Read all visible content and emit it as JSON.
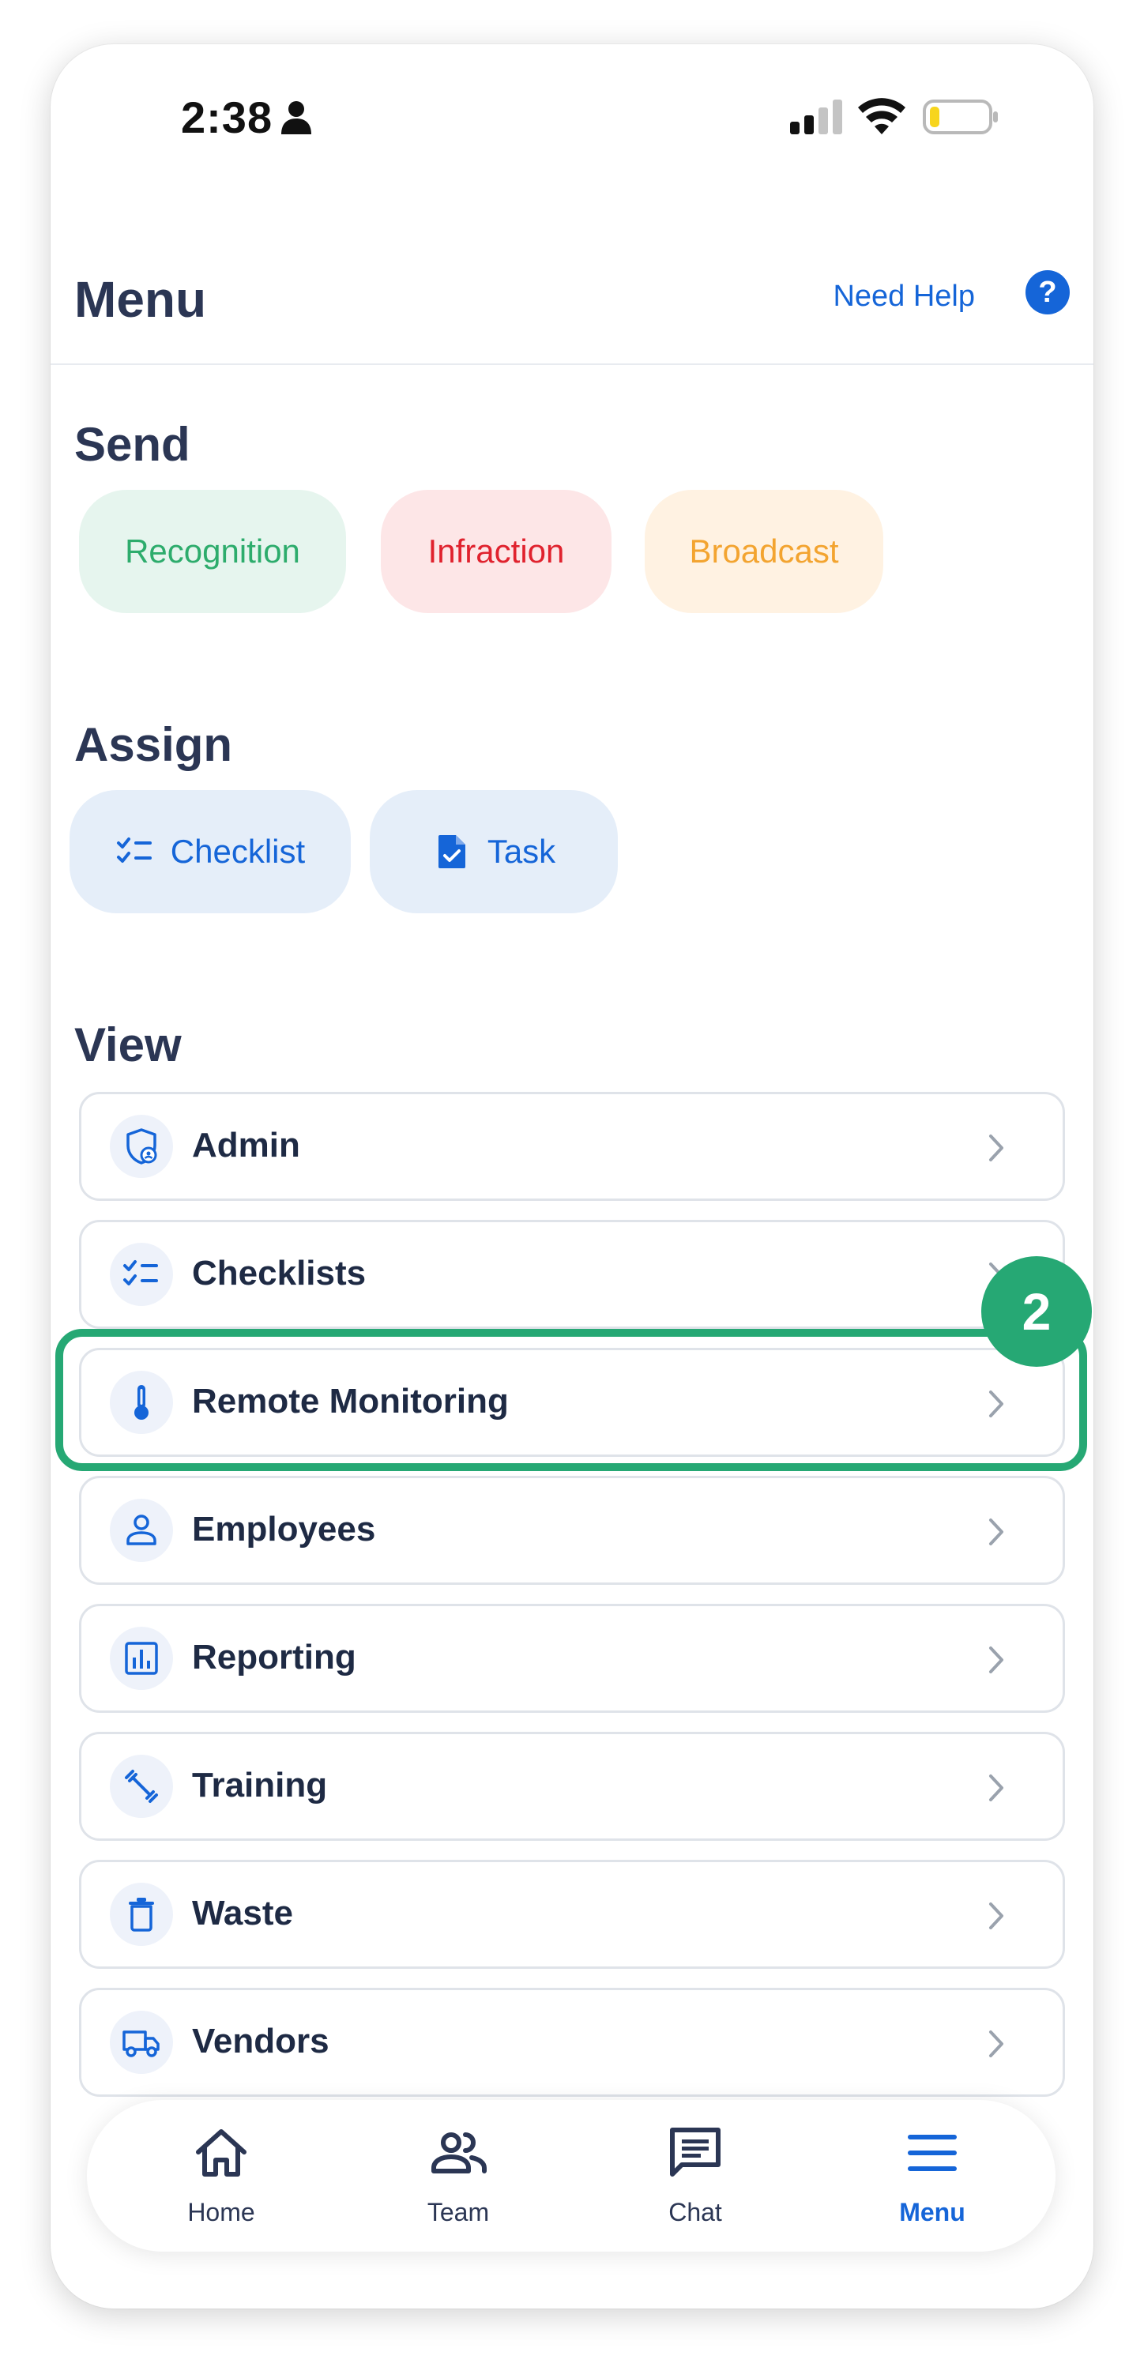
{
  "status_bar": {
    "time": "2:38"
  },
  "header": {
    "title": "Menu",
    "help_label": "Need Help",
    "help_icon_glyph": "?"
  },
  "sections": {
    "send": {
      "title": "Send",
      "chips": [
        "Recognition",
        "Infraction",
        "Broadcast"
      ]
    },
    "assign": {
      "title": "Assign",
      "chips": [
        "Checklist",
        "Task"
      ]
    },
    "view": {
      "title": "View"
    }
  },
  "list_items": [
    {
      "label": "Admin",
      "icon": "shield-user-icon"
    },
    {
      "label": "Checklists",
      "icon": "checklist-icon"
    },
    {
      "label": "Remote Monitoring",
      "icon": "thermometer-icon"
    },
    {
      "label": "Employees",
      "icon": "person-icon"
    },
    {
      "label": "Reporting",
      "icon": "bar-chart-icon"
    },
    {
      "label": "Training",
      "icon": "dumbbell-icon"
    },
    {
      "label": "Waste",
      "icon": "trash-icon"
    },
    {
      "label": "Vendors",
      "icon": "truck-icon"
    }
  ],
  "step_badge": "2",
  "bottom_nav": [
    {
      "label": "Home",
      "icon": "home-icon",
      "active": false
    },
    {
      "label": "Team",
      "icon": "team-icon",
      "active": false
    },
    {
      "label": "Chat",
      "icon": "chat-icon",
      "active": false
    },
    {
      "label": "Menu",
      "icon": "menu-icon",
      "active": true
    }
  ],
  "colors": {
    "accent": "#1565d8",
    "highlight": "#26a874",
    "recognition": "#2dac6c",
    "infraction": "#e0222e",
    "broadcast": "#f3a430"
  }
}
